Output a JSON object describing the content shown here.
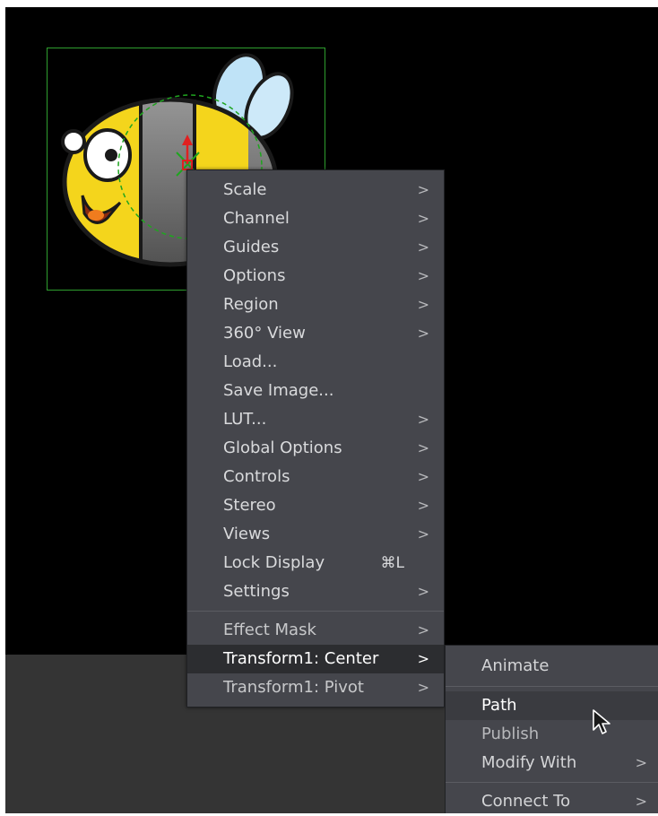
{
  "context_menu": {
    "items": [
      {
        "label": "Scale",
        "arrow": ">"
      },
      {
        "label": "Channel",
        "arrow": ">"
      },
      {
        "label": "Guides",
        "arrow": ">"
      },
      {
        "label": "Options",
        "arrow": ">"
      },
      {
        "label": "Region",
        "arrow": ">"
      },
      {
        "label": "360° View",
        "arrow": ">"
      },
      {
        "label": "Load..."
      },
      {
        "label": "Save Image..."
      },
      {
        "label": "LUT...",
        "arrow": ">"
      },
      {
        "label": "Global Options",
        "arrow": ">"
      },
      {
        "label": "Controls",
        "arrow": ">"
      },
      {
        "label": "Stereo",
        "arrow": ">"
      },
      {
        "label": "Views",
        "arrow": ">"
      },
      {
        "label": "Lock Display",
        "shortcut": "⌘L"
      },
      {
        "label": "Settings",
        "arrow": ">"
      }
    ],
    "tool_items": [
      {
        "label": "Effect Mask",
        "arrow": ">"
      },
      {
        "label": "Transform1: Center",
        "arrow": ">",
        "state": "highlighted"
      },
      {
        "label": "Transform1: Pivot",
        "arrow": ">"
      }
    ]
  },
  "submenu": {
    "items": [
      {
        "label": "Animate"
      },
      {
        "label": "Path",
        "state": "hovered"
      },
      {
        "label": "Publish"
      },
      {
        "label": "Modify With",
        "arrow": ">"
      },
      {
        "label": "Connect To",
        "arrow": ">"
      }
    ]
  },
  "viewer": {
    "image_subject": "bee-cartoon",
    "selection_box_color": "#2e9e2e",
    "menu_bg": "#45464c",
    "highlight_bg": "#2c2d30"
  },
  "icons": {
    "submenu_arrow": "chevron-right-icon",
    "cursor": "mouse-pointer-icon"
  }
}
